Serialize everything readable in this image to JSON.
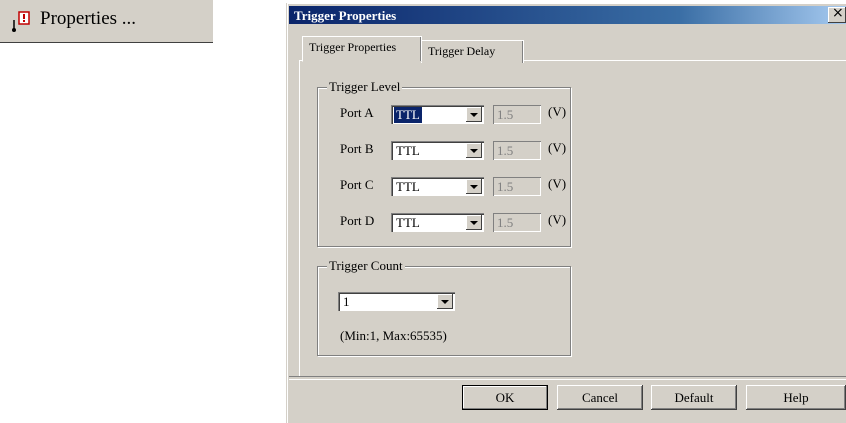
{
  "menu": {
    "label": "Properties ...",
    "icon": "trigger-properties-icon"
  },
  "dialog": {
    "title": "Trigger Properties",
    "close_label": "×",
    "tabs": [
      {
        "label": "Trigger Properties"
      },
      {
        "label": "Trigger Delay"
      }
    ],
    "trigger_level": {
      "title": "Trigger Level",
      "unit": "(V)",
      "ports": [
        {
          "label": "Port A",
          "type": "TTL",
          "voltage": "1.5"
        },
        {
          "label": "Port B",
          "type": "TTL",
          "voltage": "1.5"
        },
        {
          "label": "Port C",
          "type": "TTL",
          "voltage": "1.5"
        },
        {
          "label": "Port D",
          "type": "TTL",
          "voltage": "1.5"
        }
      ]
    },
    "trigger_count": {
      "title": "Trigger Count",
      "value": "1",
      "range_note": "(Min:1, Max:65535)"
    },
    "buttons": {
      "ok": "OK",
      "cancel": "Cancel",
      "default": "Default",
      "help": "Help"
    }
  }
}
